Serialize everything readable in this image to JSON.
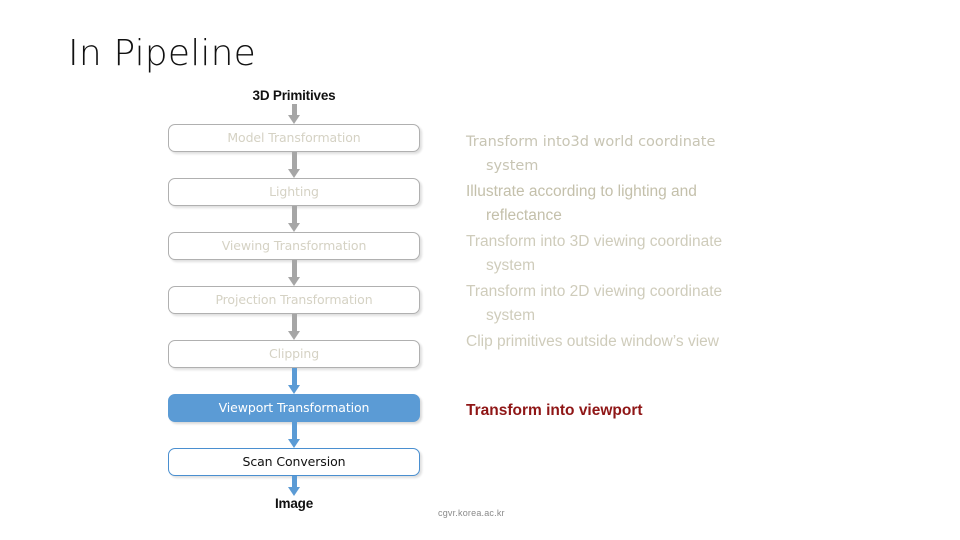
{
  "slide": {
    "title": "In Pipeline",
    "footer": "cgvr.korea.ac.kr"
  },
  "pipeline": {
    "input_label": "3D Primitives",
    "output_label": "Image",
    "stages": [
      {
        "label": "Model Transformation",
        "style": "faded"
      },
      {
        "label": "Lighting",
        "style": "faded"
      },
      {
        "label": "Viewing Transformation",
        "style": "faded"
      },
      {
        "label": "Projection Transformation",
        "style": "faded"
      },
      {
        "label": "Clipping",
        "style": "faded"
      },
      {
        "label": "Viewport Transformation",
        "style": "filled"
      },
      {
        "label": "Scan Conversion",
        "style": "outlined"
      }
    ]
  },
  "descriptions": [
    {
      "line1": "Transform into3d world coordinate",
      "line2": "system"
    },
    {
      "line1": "Illustrate according to lighting and",
      "line2": "reflectance"
    },
    {
      "line1": "Transform into 3D viewing coordinate",
      "line2": "system"
    },
    {
      "line1": "Transform into 2D viewing coordinate",
      "line2": "system"
    },
    {
      "line1": "Clip primitives outside window’s view",
      "line2": ""
    }
  ],
  "highlight_description": "Transform into viewport",
  "colors": {
    "accent_blue": "#5b9bd5",
    "highlight_red": "#8f1616",
    "faded_text": "#d5d2c4",
    "arrow_gray": "#a6a6a6"
  }
}
